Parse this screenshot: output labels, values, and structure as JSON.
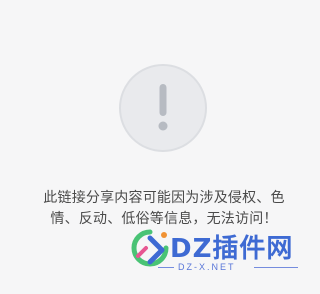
{
  "notice": {
    "icon": "exclamation-icon",
    "message": "此链接分享内容可能因为涉及侵权、色情、反动、低俗等信息，无法访问！"
  },
  "watermark": {
    "title": "DZ插件网",
    "subtitle": "DZ-X.NET",
    "colors": {
      "blue": "#2f5fd0",
      "green": "#3bbf6a",
      "orange": "#f08a24",
      "pink": "#e64a8a"
    }
  }
}
